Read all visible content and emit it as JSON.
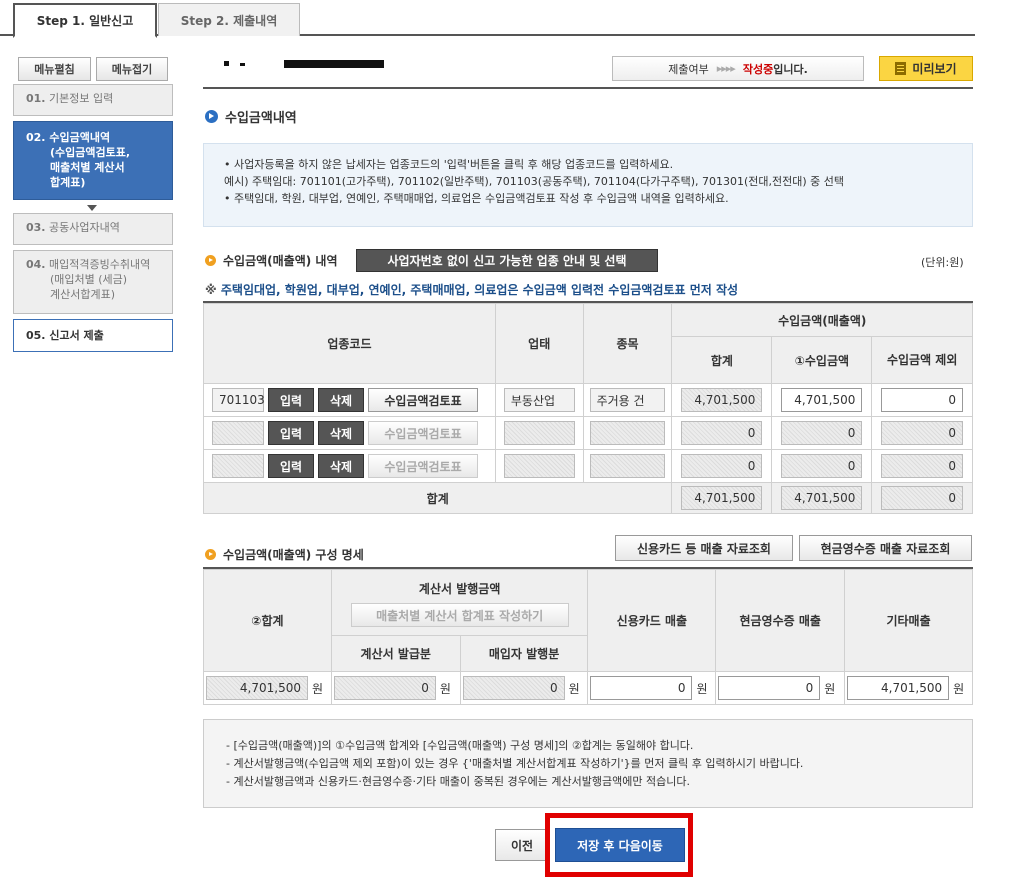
{
  "steps": [
    {
      "label": "Step 1. 일반신고",
      "active": true
    },
    {
      "label": "Step 2. 제출내역",
      "active": false
    }
  ],
  "menu": {
    "expand": "메뉴펼침",
    "collapse": "메뉴접기"
  },
  "nav": [
    {
      "num": "01.",
      "label": "기본정보 입력"
    },
    {
      "num": "02.",
      "label": "수입금액내역",
      "sub": [
        "(수입금액검토표,",
        "매출처별 계산서",
        "합계표)"
      ]
    },
    {
      "num": "03.",
      "label": "공동사업자내역"
    },
    {
      "num": "04.",
      "label": "매입적격증빙수취내역",
      "sub": [
        "(매입처별 (세금)",
        "계산서합계표)"
      ]
    },
    {
      "num": "05.",
      "label": "신고서 제출"
    }
  ],
  "status": {
    "label": "제출여부",
    "arrows": "▸▸▸▸",
    "state_red": "작성중",
    "state_suffix": "입니다."
  },
  "preview": "미리보기",
  "section1": {
    "title": "수입금액내역",
    "info": [
      "•  사업자등록을 하지 않은 납세자는 업종코드의 '입력'버튼을 클릭 후 해당 업종코드를 입력하세요.",
      "   예시) 주택임대: 701101(고가주택), 701102(일반주택), 701103(공동주택), 701104(다가구주택), 701301(전대,전전대) 중 선택",
      "•  주택임대, 학원, 대부업, 연예인, 주택매매업, 의료업은 수입금액검토표 작성 후 수입금액 내역을 입력하세요."
    ]
  },
  "section2": {
    "title": "수입금액(매출액) 내역",
    "guide_button": "사업자번호 없이 신고 가능한 업종 안내 및 선택",
    "unit": "(단위:원)",
    "notice_mark": "※",
    "notice": "주택임대업, 학원업, 대부업, 연예인, 주택매매업, 의료업은 수입금액 입력전 수입금액검토표 먼저 작성",
    "headers": {
      "code": "업종코드",
      "type": "업태",
      "item": "종목",
      "income": "수입금액(매출액)",
      "total": "합계",
      "income1": "①수입금액",
      "exclude": "수입금액 제외"
    },
    "buttons": {
      "input": "입력",
      "delete": "삭제",
      "review": "수입금액검토표"
    },
    "rows": [
      {
        "code": "701103",
        "type": "부동산업",
        "item": "주거용 건",
        "total": "4,701,500",
        "income": "4,701,500",
        "exclude": "0",
        "review_enabled": true
      },
      {
        "code": "",
        "type": "",
        "item": "",
        "total": "0",
        "income": "0",
        "exclude": "0",
        "review_enabled": false
      },
      {
        "code": "",
        "type": "",
        "item": "",
        "total": "0",
        "income": "0",
        "exclude": "0",
        "review_enabled": false
      }
    ],
    "sum": {
      "label": "합계",
      "total": "4,701,500",
      "income": "4,701,500",
      "exclude": "0"
    }
  },
  "section3": {
    "title": "수입금액(매출액) 구성 명세",
    "card_btn": "신용카드 등 매출 자료조회",
    "cash_btn": "현금영수증 매출 자료조회",
    "headers": {
      "total": "②합계",
      "invoice": "계산서 발행금액",
      "invoice_btn": "매출처별 계산서 합계표 작성하기",
      "issued": "계산서 발급분",
      "buyer": "매입자 발행분",
      "card": "신용카드 매출",
      "cash": "현금영수증 매출",
      "other": "기타매출"
    },
    "values": {
      "total": "4,701,500",
      "issued": "0",
      "buyer": "0",
      "card": "0",
      "cash": "0",
      "other": "4,701,500"
    },
    "won": "원"
  },
  "notes": [
    "- [수입금액(매출액)]의 ①수입금액 합계와 [수입금액(매출액) 구성 명세]의 ②합계는 동일해야 합니다.",
    "- 계산서발행금액(수입금액 제외 포함)이 있는 경우 {'매출처별 계산서합계표 작성하기'}를 먼저 클릭 후 입력하시기 바랍니다.",
    "- 계산서발행금액과 신용카드·현금영수증·기타 매출이 중복된 경우에는 계산서발행금액에만 적습니다."
  ],
  "footer": {
    "prev": "이전",
    "save_next": "저장 후 다음이동"
  }
}
